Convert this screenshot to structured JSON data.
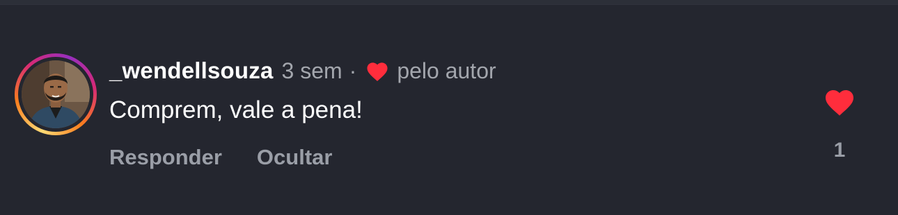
{
  "comment": {
    "username": "_wendellsouza",
    "time": "3 sem",
    "separator": "·",
    "author_like_label": "pelo autor",
    "text": "Comprem, vale a pena!",
    "actions": {
      "reply": "Responder",
      "hide": "Ocultar"
    },
    "likes": {
      "count": "1",
      "liked": true
    }
  },
  "icons": {
    "author_heart": "heart-icon",
    "like_heart": "heart-icon",
    "avatar": "user-photo"
  },
  "colors": {
    "background": "#24262f",
    "heart": "#ff2d3c",
    "secondary_text": "#a3a6ad",
    "primary_text": "#ffffff",
    "story_ring": [
      "#feda75",
      "#fa7e1e",
      "#d62976",
      "#962fbf"
    ]
  }
}
